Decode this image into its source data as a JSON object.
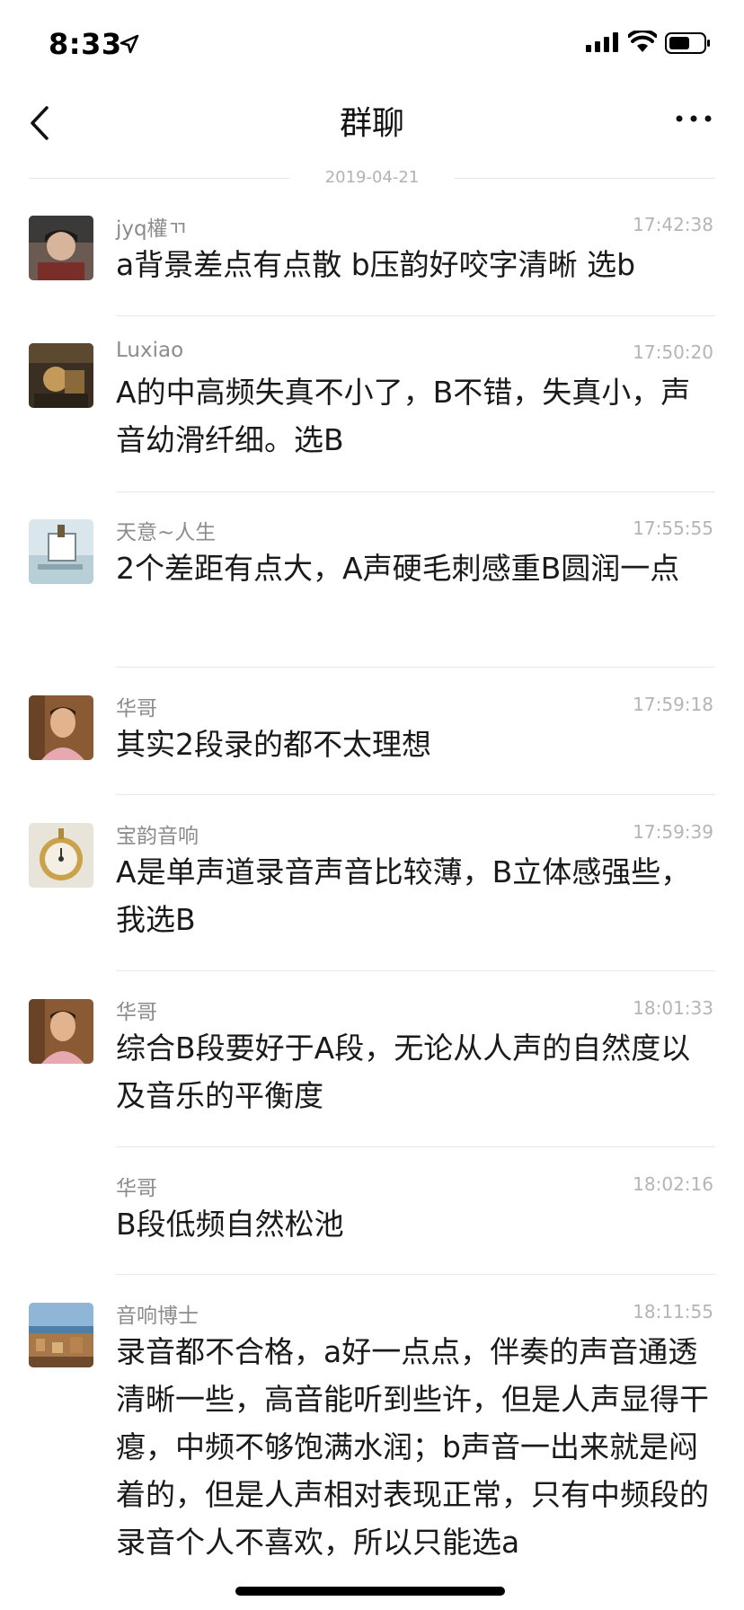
{
  "status_bar": {
    "time": "8:33"
  },
  "header": {
    "title": "群聊"
  },
  "date_separator": "2019-04-21",
  "messages": [
    {
      "name": "jyq權ㄲ",
      "time": "17:42:38",
      "text": "a背景差点有点散 b压韵好咬字清晰 选b"
    },
    {
      "name": "Luxiao",
      "time": "17:50:20",
      "text": "A的中高频失真不小了，B不错，失真小，声音幼滑纤细。选B"
    },
    {
      "name": "天意~人生",
      "time": "17:55:55",
      "text": "2个差距有点大，A声硬毛刺感重B圆润一点"
    },
    {
      "name": "华哥",
      "time": "17:59:18",
      "text": "其实2段录的都不太理想"
    },
    {
      "name": "宝韵音响",
      "time": "17:59:39",
      "text": "A是单声道录音声音比较薄，B立体感强些，我选B"
    },
    {
      "name": "华哥",
      "time": "18:01:33",
      "text": "综合B段要好于A段，无论从人声的自然度以及音乐的平衡度"
    },
    {
      "name": "华哥",
      "time": "18:02:16",
      "text": "B段低频自然松池"
    },
    {
      "name": "音响博士",
      "time": "18:11:55",
      "text": "录音都不合格，a好一点点，伴奏的声音通透清晰一些，高音能听到些许，但是人声显得干瘪，中频不够饱满水润；b声音一出来就是闷着的，但是人声相对表现正常，只有中频段的录音个人不喜欢，所以只能选a"
    }
  ]
}
